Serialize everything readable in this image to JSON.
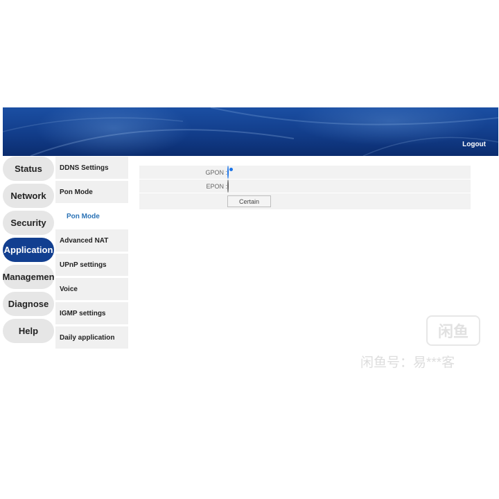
{
  "header": {
    "logout_label": "Logout"
  },
  "main_nav": {
    "items": [
      {
        "label": "Status"
      },
      {
        "label": "Network"
      },
      {
        "label": "Security"
      },
      {
        "label": "Application",
        "active": true
      },
      {
        "label": "Managemen"
      },
      {
        "label": "Diagnose"
      },
      {
        "label": "Help"
      }
    ]
  },
  "sub_nav": {
    "items": [
      {
        "label": "DDNS Settings"
      },
      {
        "label": "Pon Mode"
      },
      {
        "label": "Pon Mode",
        "child": true,
        "active": true
      },
      {
        "label": "Advanced NAT"
      },
      {
        "label": "UPnP settings"
      },
      {
        "label": "Voice"
      },
      {
        "label": "IGMP settings"
      },
      {
        "label": "Daily application"
      }
    ]
  },
  "form": {
    "gpon_label": "GPON :",
    "epon_label": "EPON :",
    "selected": "GPON",
    "submit_label": "Certain"
  },
  "watermark": {
    "logo_text": "闲鱼",
    "text": "闲鱼号：易***客"
  },
  "colors": {
    "banner": "#123d8a",
    "active_nav": "#123f90",
    "sub_active_text": "#2a72b5",
    "radio_selected": "#1a73e8"
  }
}
